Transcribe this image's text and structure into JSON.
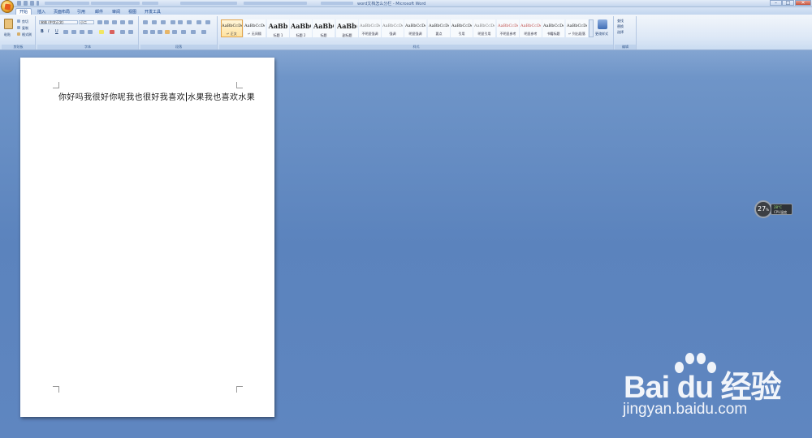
{
  "window": {
    "title": "word文档怎么分栏 - Microsoft Word",
    "min": "–",
    "max": "□",
    "close": "✕"
  },
  "tabs": [
    "开始",
    "插入",
    "页面布局",
    "引用",
    "邮件",
    "审阅",
    "视图",
    "开发工具"
  ],
  "clipboard": {
    "paste": "粘贴",
    "cut": "剪切",
    "copy": "复制",
    "painter": "格式刷",
    "label": "剪贴板"
  },
  "font": {
    "name": "宋体 (中文正文)",
    "size": "小二",
    "label": "字体",
    "bold": "B",
    "italic": "I",
    "underline": "U"
  },
  "paragraph": {
    "label": "段落"
  },
  "styles": {
    "label": "样式",
    "items": [
      {
        "sample": "AaBbCcDd",
        "name": "↵ 正文"
      },
      {
        "sample": "AaBbCcDd",
        "name": "↵ 无间隔"
      },
      {
        "sample": "AaBb",
        "name": "标题 1"
      },
      {
        "sample": "AaBbC",
        "name": "标题 2"
      },
      {
        "sample": "AaBbC",
        "name": "标题"
      },
      {
        "sample": "AaBb(",
        "name": "副标题"
      },
      {
        "sample": "AaBbCcDd",
        "name": "不明显强调"
      },
      {
        "sample": "AaBbCcDd",
        "name": "强调"
      },
      {
        "sample": "AaBbCcDd",
        "name": "明显强调"
      },
      {
        "sample": "AaBbCcDd",
        "name": "要点"
      },
      {
        "sample": "AaBbCcDd",
        "name": "引用"
      },
      {
        "sample": "AaBbCcDd",
        "name": "明显引用"
      },
      {
        "sample": "AaBbCcDd",
        "name": "不明显参考"
      },
      {
        "sample": "AaBbCcDd",
        "name": "明显参考"
      },
      {
        "sample": "AaBbCcDd",
        "name": "书籍标题"
      },
      {
        "sample": "AaBbCcDd",
        "name": "↵ 列出段落"
      }
    ],
    "change": "更改样式"
  },
  "editing": {
    "find": "查找",
    "replace": "替换",
    "select": "选择",
    "label": "编辑"
  },
  "document": {
    "text_before": "你好吗我很好你呢我也很好我喜欢",
    "text_after": "水果我也喜欢水果"
  },
  "gadget": {
    "percent": "27",
    "unit": "%",
    "temp": "28°C",
    "label": "CPU温度"
  },
  "watermark": {
    "logo": "Bai du 经验",
    "url": "jingyan.baidu.com"
  }
}
